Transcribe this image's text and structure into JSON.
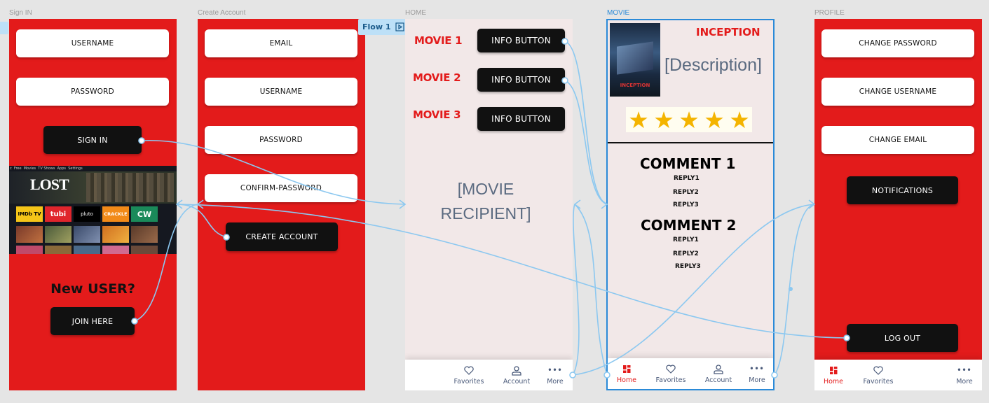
{
  "frames": {
    "signin": "Sign IN",
    "create": "Create Account",
    "home": "HOME",
    "movie": "MOVIE",
    "profile": "PROFILE"
  },
  "signin": {
    "username": "USERNAME",
    "password": "PASSWORD",
    "signin_button": "SIGN IN",
    "banner_title": "LOST",
    "banner_tabs": "c  Free  Movies  TV Shows  Apps  Settings",
    "apps": [
      "IMDb TV",
      "tubi",
      "pluto",
      "CRACKLE",
      "CW"
    ],
    "new_user": "New USER?",
    "join_button": "JOIN HERE"
  },
  "create": {
    "email": "EMAIL",
    "username": "USERNAME",
    "password": "PASSWORD",
    "confirm": "CONFIRM-PASSWORD",
    "create_button": "CREATE ACCOUNT"
  },
  "flow": {
    "label": "Flow 1"
  },
  "home": {
    "movies": [
      {
        "title": "MOVIE 1",
        "button": "INFO BUTTON"
      },
      {
        "title": "MOVIE 2",
        "button": "INFO BUTTON"
      },
      {
        "title": "MOVIE 3",
        "button": "INFO BUTTON"
      }
    ],
    "recipient": "[MOVIE RECIPIENT]",
    "nav": {
      "favorites": "Favorites",
      "account": "Account",
      "more": "More"
    }
  },
  "movie": {
    "title": "INCEPTION",
    "poster_title": "INCEPTION",
    "description": "[Description]",
    "rating_stars": 5,
    "comments": [
      {
        "title": "COMMENT 1",
        "replies": [
          "REPLY1",
          "REPLY2",
          "REPLY3"
        ]
      },
      {
        "title": "COMMENT 2",
        "replies": [
          "REPLY1",
          "REPLY2",
          "REPLY3"
        ]
      }
    ],
    "nav": {
      "home": "Home",
      "favorites": "Favorites",
      "account": "Account",
      "more": "More"
    }
  },
  "profile": {
    "change_password": "CHANGE PASSWORD",
    "change_username": "CHANGE USERNAME",
    "change_email": "CHANGE EMAIL",
    "notifications": "NOTIFICATIONS",
    "logout": "LOG OUT",
    "nav": {
      "home": "Home",
      "favorites": "Favorites",
      "more": "More"
    }
  },
  "colors": {
    "brand_red": "#e31b1b",
    "wire": "#8cc8f0",
    "selection": "#2a8ad8"
  }
}
